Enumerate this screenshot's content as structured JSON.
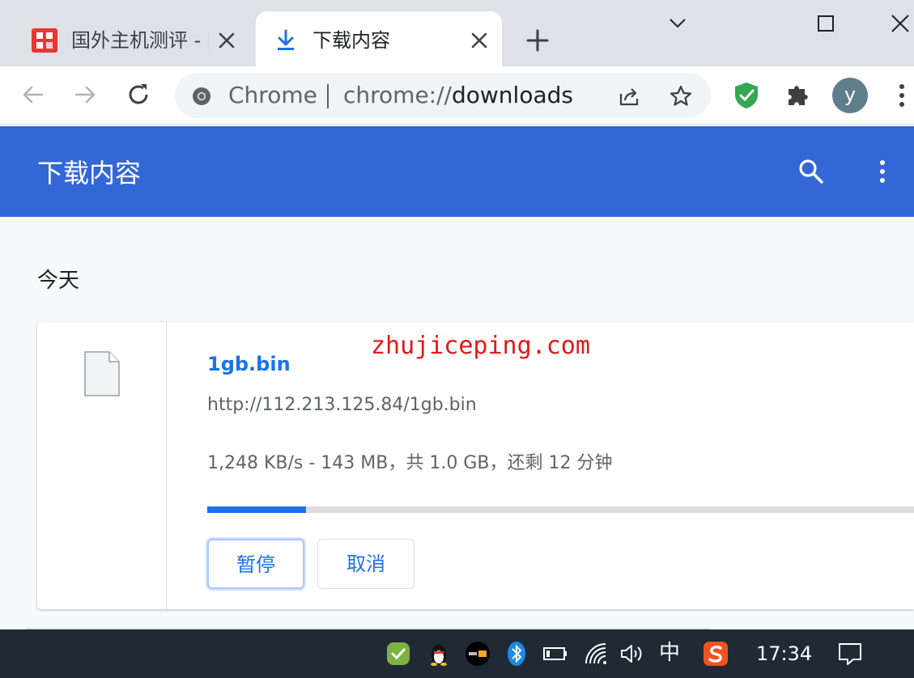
{
  "tabs": [
    {
      "title": "国外主机测评 - [",
      "active": false
    },
    {
      "title": "下载内容",
      "active": true
    }
  ],
  "toolbar": {
    "site_chip": "Chrome",
    "url_scheme": "chrome://",
    "url_path": "downloads",
    "avatar_letter": "y"
  },
  "page": {
    "title": "下载内容",
    "date_group": "今天"
  },
  "download": {
    "file_name": "1gb.bin",
    "url": "http://112.213.125.84/1gb.bin",
    "status": "1,248 KB/s - 143 MB，共 1.0 GB，还剩 12 分钟",
    "progress_fraction": 0.14,
    "pause_label": "暂停",
    "cancel_label": "取消"
  },
  "watermark": "zhujiceping.com",
  "taskbar": {
    "ime": "中",
    "clock": "17:34"
  },
  "colors": {
    "header_blue": "#3367d6",
    "link_blue": "#1a73e8",
    "taskbar": "#1f2a35"
  }
}
